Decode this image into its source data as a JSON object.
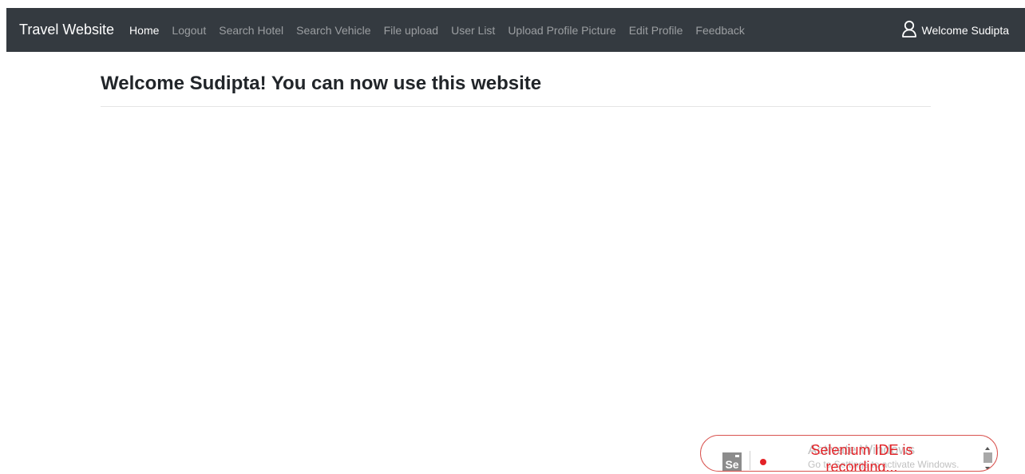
{
  "navbar": {
    "brand": "Travel Website",
    "links": [
      {
        "label": "Home",
        "active": true
      },
      {
        "label": "Logout",
        "active": false
      },
      {
        "label": "Search Hotel",
        "active": false
      },
      {
        "label": "Search Vehicle",
        "active": false
      },
      {
        "label": "File upload",
        "active": false
      },
      {
        "label": "User List",
        "active": false
      },
      {
        "label": "Upload Profile Picture",
        "active": false
      },
      {
        "label": "Edit Profile",
        "active": false
      },
      {
        "label": "Feedback",
        "active": false
      }
    ],
    "user": {
      "icon": "user-icon",
      "label": "Welcome Sudipta"
    }
  },
  "main": {
    "title": "Welcome Sudipta! You can now use this website"
  },
  "selenium_badge": {
    "logo_text": "Se",
    "status_text": "Selenium IDE is recording...",
    "status_color": "#e32227"
  },
  "watermark": {
    "title": "Activate Windows",
    "subtitle": "Go to Settings to activate Windows."
  },
  "colors": {
    "navbar_bg": "#343a40",
    "nav_link_inactive": "rgba(255,255,255,0.5)",
    "nav_link_active": "#ffffff",
    "recording_red": "#e32227"
  }
}
